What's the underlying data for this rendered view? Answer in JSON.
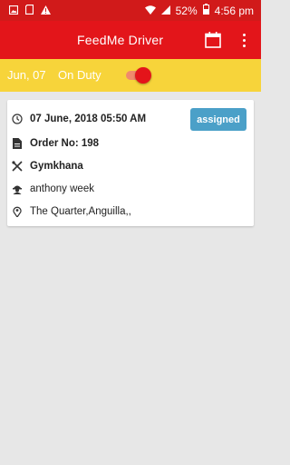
{
  "status_bar": {
    "battery": "52%",
    "time": "4:56 pm",
    "icons": [
      "image-icon",
      "sd-card-icon",
      "warning-icon",
      "wifi-icon",
      "signal-icon",
      "battery-icon"
    ]
  },
  "app_bar": {
    "title": "FeedMe Driver",
    "icons": [
      "calendar-icon",
      "more-vert-icon"
    ]
  },
  "duty_bar": {
    "date": "Jun, 07",
    "status": "On Duty",
    "toggle_on": true
  },
  "orders": [
    {
      "datetime": "07 June, 2018 05:50 AM",
      "order_no": "Order No: 198",
      "restaurant": "Gymkhana",
      "customer": "anthony week",
      "address": "The Quarter,Anguilla,,",
      "status": "assigned"
    }
  ],
  "colors": {
    "primary": "#e3151a",
    "status_bar": "#d11a1a",
    "duty_bar": "#f7d43a",
    "badge": "#4ba0c8",
    "background": "#e7e7e7"
  }
}
